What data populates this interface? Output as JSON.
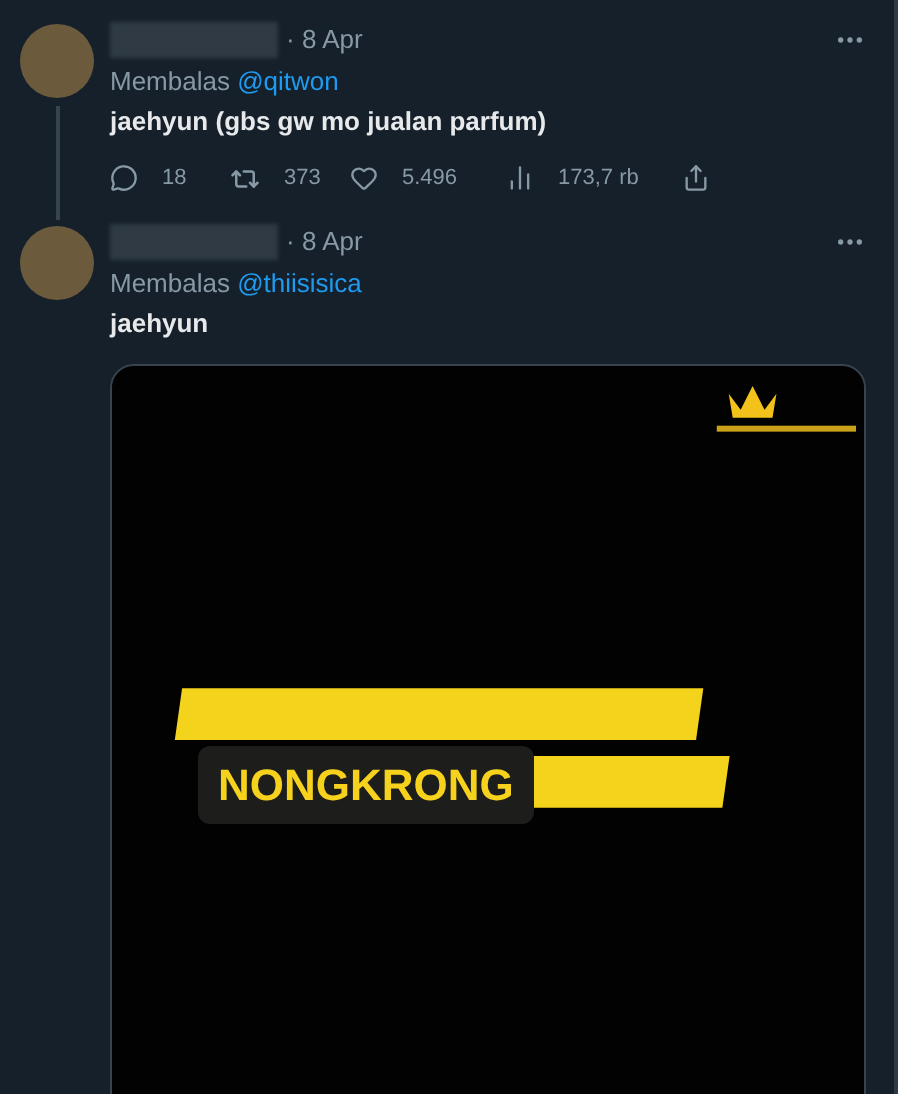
{
  "tweets": [
    {
      "date": "· 8 Apr",
      "reply_label": "Membalas",
      "reply_to": "@qitwon",
      "text": "jaehyun (gbs gw mo jualan parfum)",
      "thread_line": true,
      "actions": {
        "replies": "18",
        "retweets": "373",
        "likes": "5.496",
        "views": "173,7 rb"
      }
    },
    {
      "date": "· 8 Apr",
      "reply_label": "Membalas",
      "reply_to": "@thiisisica",
      "text": "jaehyun",
      "thread_line": false,
      "media": {
        "kind": "picture",
        "sticker": "NONGKRONG"
      }
    }
  ]
}
